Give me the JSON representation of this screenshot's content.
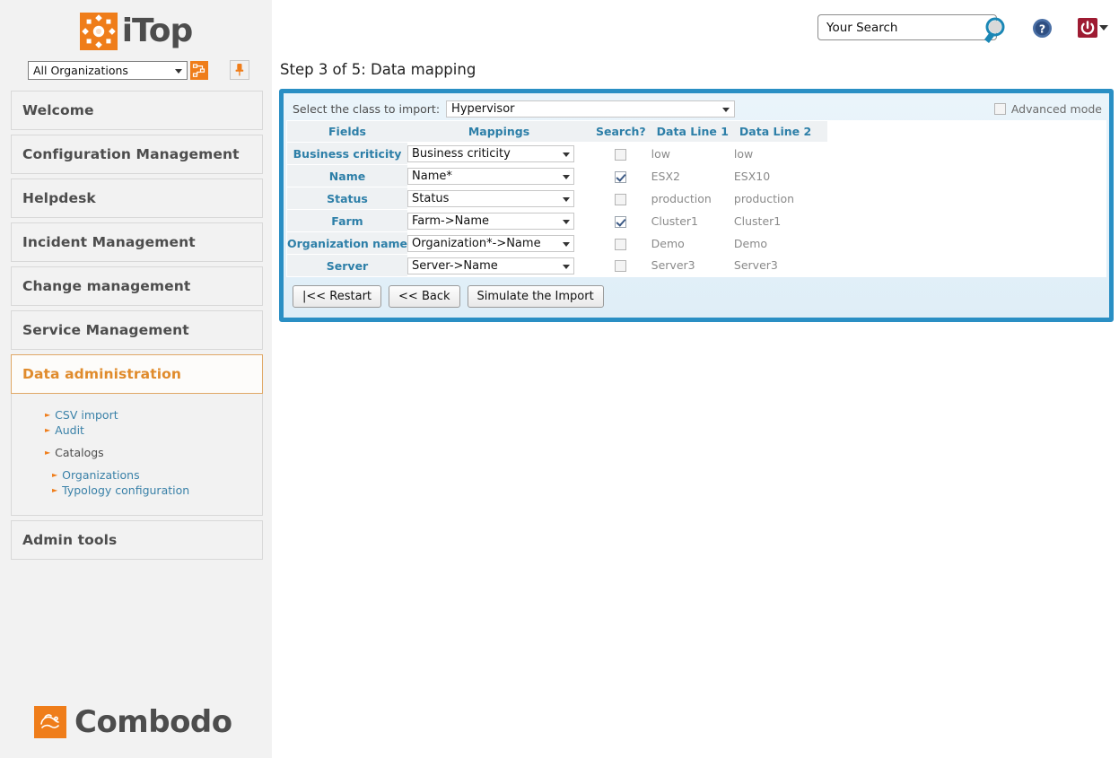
{
  "brand": {
    "logo_text": "iTop",
    "logo_icon": "itop-logo-icon",
    "footer_text": "Combodo",
    "footer_icon": "combodo-logo-icon",
    "accent_orange": "#ef7d1a",
    "accent_blue": "#2a8fc4",
    "link_blue": "#3a81a8"
  },
  "org_bar": {
    "selected": "All Organizations",
    "switch_icon": "organization-switch-icon",
    "pin_icon": "pin-icon"
  },
  "topbar": {
    "search_value": "Your Search",
    "search_placeholder": "Your Search",
    "search_icon": "search-magnifier-icon",
    "help_icon": "help-question-icon",
    "power_icon": "power-logout-icon",
    "power_caret_icon": "chevron-down-icon"
  },
  "page": {
    "title": "Step 3 of 5: Data mapping"
  },
  "sidebar": {
    "items": [
      {
        "label": "Welcome",
        "active": false
      },
      {
        "label": "Configuration Management",
        "active": false
      },
      {
        "label": "Helpdesk",
        "active": false
      },
      {
        "label": "Incident Management",
        "active": false
      },
      {
        "label": "Change management",
        "active": false
      },
      {
        "label": "Service Management",
        "active": false
      },
      {
        "label": "Data administration",
        "active": true
      },
      {
        "label": "Admin tools",
        "active": false
      }
    ],
    "submenu": [
      {
        "label": "CSV import",
        "level": 1,
        "link": true
      },
      {
        "label": "Audit",
        "level": 1,
        "link": true
      },
      {
        "label": "Catalogs",
        "level": 1,
        "link": false
      },
      {
        "label": "Organizations",
        "level": 2,
        "link": true
      },
      {
        "label": "Typology configuration",
        "level": 2,
        "link": true
      }
    ]
  },
  "wizard": {
    "class_label": "Select the class to import:",
    "class_selected": "Hypervisor",
    "advanced_mode_label": "Advanced mode",
    "advanced_mode_checked": false,
    "columns": {
      "fields": "Fields",
      "mappings": "Mappings",
      "search": "Search?",
      "data_line_1": "Data Line 1",
      "data_line_2": "Data Line 2"
    },
    "rows": [
      {
        "field": "Business criticity",
        "mapping": "Business criticity",
        "search": false,
        "d1": "low",
        "d2": "low"
      },
      {
        "field": "Name",
        "mapping": "Name*",
        "search": true,
        "d1": "ESX2",
        "d2": "ESX10"
      },
      {
        "field": "Status",
        "mapping": "Status",
        "search": false,
        "d1": "production",
        "d2": "production"
      },
      {
        "field": "Farm",
        "mapping": "Farm->Name",
        "search": true,
        "d1": "Cluster1",
        "d2": "Cluster1"
      },
      {
        "field": "Organization name",
        "mapping": "Organization*->Name",
        "search": false,
        "d1": "Demo",
        "d2": "Demo"
      },
      {
        "field": "Server",
        "mapping": "Server->Name",
        "search": false,
        "d1": "Server3",
        "d2": "Server3"
      }
    ],
    "buttons": {
      "restart": "|<< Restart",
      "back": "<< Back",
      "simulate": "Simulate the Import"
    }
  }
}
